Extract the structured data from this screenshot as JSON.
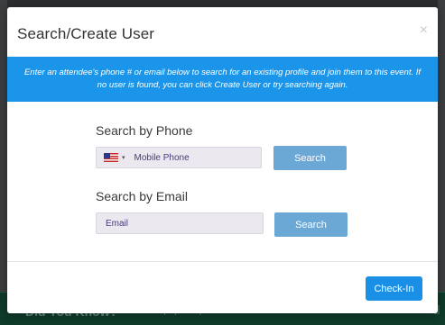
{
  "modal": {
    "title": "Search/Create User",
    "close_glyph": "×",
    "info_text": "Enter an attendee's phone # or email below to search for an existing profile and join them to this event. If no user is found, you can click Create User or try searching again."
  },
  "phone_search": {
    "label": "Search by Phone",
    "country_flag_icon": "us-flag-icon",
    "caret": "▾",
    "placeholder": "Mobile Phone",
    "button_label": "Search"
  },
  "email_search": {
    "label": "Search by Email",
    "placeholder": "Email",
    "button_label": "Search"
  },
  "footer": {
    "checkin_label": "Check-In"
  },
  "background_banner": {
    "title": "Did You Know?",
    "subtitle": "Help speed up check-in."
  },
  "colors": {
    "info_bar": "#1a95ea",
    "search_button": "#6ca8d6",
    "checkin_button": "#1a8fe6",
    "input_bg": "#ebe8f0",
    "banner_bg": "#0e3b2a"
  }
}
